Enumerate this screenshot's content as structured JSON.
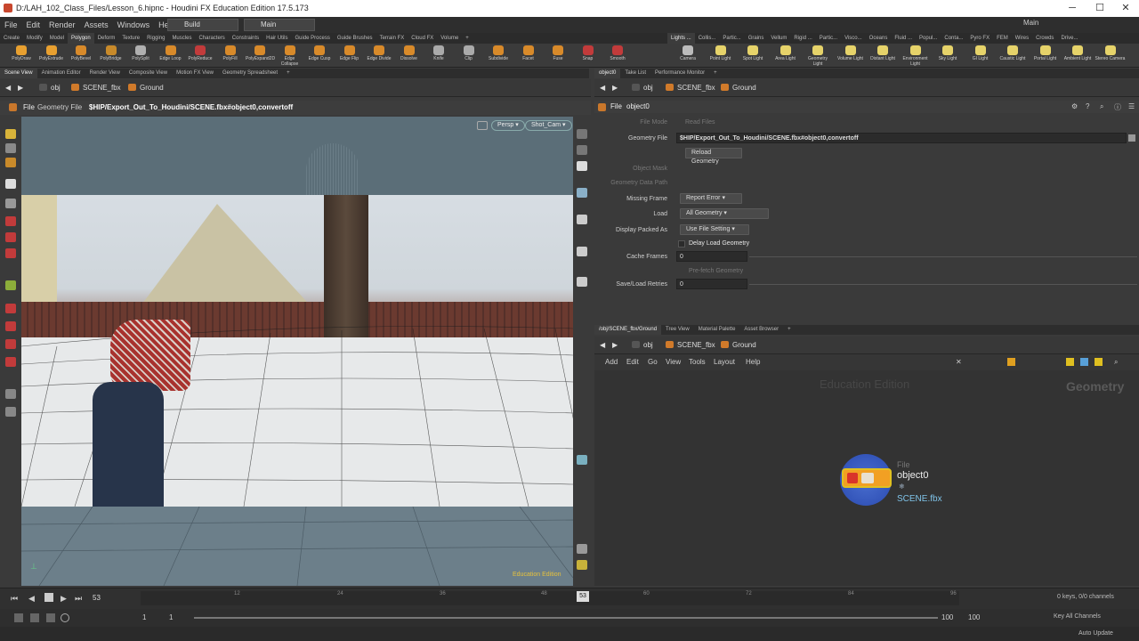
{
  "titlebar": {
    "title": "D:/LAH_102_Class_Files/Lesson_6.hipnc - Houdini FX Education Edition 17.5.173",
    "minimize": "─",
    "maximize": "☐",
    "close": "✕"
  },
  "menu": [
    "File",
    "Edit",
    "Render",
    "Assets",
    "Windows",
    "Help"
  ],
  "desktops": {
    "build": "Build",
    "main": "Main",
    "right_main": "Main"
  },
  "shelf_tabs_left": [
    "Create",
    "Modify",
    "Model",
    "Polygon",
    "Deform",
    "Texture",
    "Rigging",
    "Muscles",
    "Characters",
    "Constraints",
    "Hair Utils",
    "Guide Process",
    "Guide Brushes",
    "Terrain FX",
    "Cloud FX",
    "Volume"
  ],
  "shelf_tabs_right": [
    "Lights ...",
    "Collis...",
    "Partic...",
    "Grains",
    "Vellum",
    "Rigid ...",
    "Partic...",
    "Visco...",
    "Oceans",
    "Fluid ...",
    "Popul...",
    "Conta...",
    "Pyro FX",
    "FEM",
    "Wires",
    "Crowds",
    "Drive..."
  ],
  "shelf_tools_left": [
    "PolyDraw",
    "PolyExtrude",
    "PolyBevel",
    "PolyBridge",
    "PolySplit",
    "Edge Loop",
    "PolyReduce",
    "PolyFill",
    "PolyExpand2D",
    "Edge Collapse",
    "Edge Cusp",
    "Edge Flip",
    "Edge Divide",
    "Dissolve",
    "Knife",
    "Clip",
    "Subdivide",
    "Facet",
    "Fuse",
    "Snap",
    "Smooth"
  ],
  "shelf_tools_right": [
    "Camera",
    "Point Light",
    "Spot Light",
    "Area Light",
    "Geometry Light",
    "Volume Light",
    "Distant Light",
    "Environment Light",
    "Sky Light",
    "GI Light",
    "Caustic Light",
    "Portal Light",
    "Ambient Light",
    "Stereo Camera"
  ],
  "pane_tabs_left": [
    "Scene View",
    "Animation Editor",
    "Render View",
    "Composite View",
    "Motion FX View",
    "Geometry Spreadsheet"
  ],
  "pane_tabs_right": [
    "object0",
    "Take List",
    "Performance Monitor"
  ],
  "path": {
    "obj": "obj",
    "scene": "SCENE_fbx",
    "ground": "Ground"
  },
  "viewport": {
    "node_type": "File",
    "node_label": "Geometry File",
    "path": "$HIP/Export_Out_To_Houdini/SCENE.fbx#object0,convertoff",
    "persp": "Persp",
    "camera": "Shot_Cam",
    "watermark": "Education Edition"
  },
  "params": {
    "header_type": "File",
    "header_name": "object0",
    "file_mode_label": "File Mode",
    "file_mode_value": "Read Files",
    "geometry_file_label": "Geometry File",
    "geometry_file_value": "$HIP/Export_Out_To_Houdini/SCENE.fbx#object0,convertoff",
    "reload_button": "Reload Geometry",
    "object_mask_label": "Object Mask",
    "geometry_data_path_label": "Geometry Data Path",
    "missing_frame_label": "Missing Frame",
    "missing_frame_value": "Report Error",
    "load_label": "Load",
    "load_value": "All Geometry",
    "display_packed_label": "Display Packed As",
    "display_packed_value": "Use File Setting",
    "delay_load_label": "Delay Load Geometry",
    "cache_frames_label": "Cache Frames",
    "cache_frames_value": "0",
    "prefetch_label": "Pre-fetch Geometry",
    "retries_label": "Save/Load Retries",
    "retries_value": "0"
  },
  "network": {
    "tabs": [
      "/obj/SCENE_fbx/Ground",
      "Tree View",
      "Material Palette",
      "Asset Browser"
    ],
    "menu": [
      "Add",
      "Edit",
      "Go",
      "View",
      "Tools",
      "Layout",
      "Help"
    ],
    "watermark": "Education Edition",
    "context_label": "Geometry",
    "node_type": "File",
    "node_name": "object0",
    "node_file": "SCENE.fbx"
  },
  "timeline": {
    "current_frame": "53",
    "frame_marker": "53",
    "ticks": [
      "12",
      "24",
      "36",
      "48",
      "60",
      "72",
      "84",
      "96"
    ],
    "keys_info": "0 keys, 0/0 channels",
    "key_all": "Key All Channels"
  },
  "range": {
    "start": "1",
    "start2": "1",
    "end": "100",
    "end2": "100"
  },
  "status": {
    "auto_update": "Auto Update"
  }
}
